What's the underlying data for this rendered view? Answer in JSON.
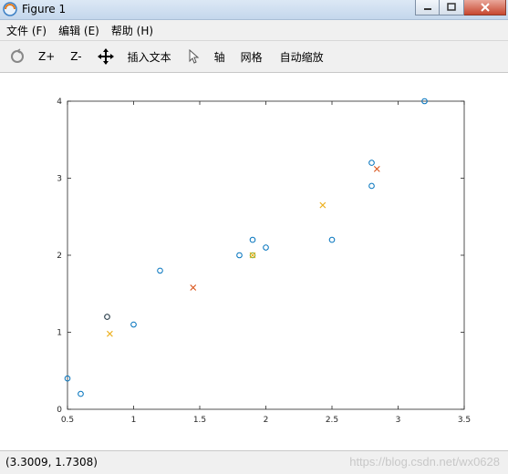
{
  "window": {
    "title": "Figure 1"
  },
  "menu": {
    "items": [
      "文件 (F)",
      "编辑 (E)",
      "帮助 (H)"
    ]
  },
  "toolbar": {
    "zoom_in": "Z+",
    "zoom_out": "Z-",
    "insert_text": "插入文本",
    "axes": "轴",
    "grid": "网格",
    "autoscale": "自动缩放"
  },
  "status": {
    "coordinates": "(3.3009, 1.7308)",
    "watermark": "https://blog.csdn.net/wx0628"
  },
  "colors": {
    "data_points": "#0072bd",
    "centroid_initial": "#edb120",
    "centroid_final": "#d95319",
    "highlight": "#7e2f8e"
  },
  "chart_data": {
    "type": "scatter",
    "xlim": [
      0.5,
      3.5
    ],
    "ylim": [
      0,
      4
    ],
    "xticks": [
      "0.5",
      "1",
      "1.5",
      "2",
      "2.5",
      "3",
      "3.5"
    ],
    "yticks": [
      "0",
      "1",
      "2",
      "3",
      "4"
    ],
    "grid": false,
    "series": [
      {
        "marker": "o",
        "color": "#0072bd",
        "points": [
          [
            0.5,
            0.4
          ],
          [
            0.6,
            0.2
          ],
          [
            0.8,
            1.2
          ],
          [
            1.0,
            1.1
          ],
          [
            1.2,
            1.8
          ],
          [
            1.8,
            2.0
          ],
          [
            1.9,
            2.2
          ],
          [
            2.0,
            2.1
          ],
          [
            2.5,
            2.2
          ],
          [
            2.8,
            3.2
          ],
          [
            2.8,
            2.9
          ],
          [
            3.2,
            4.0
          ]
        ]
      },
      {
        "marker": "o",
        "color": "#77ac30",
        "points": [
          [
            1.9,
            2.0
          ]
        ]
      },
      {
        "marker": "o",
        "color": "#444444",
        "points": [
          [
            0.8,
            1.2
          ]
        ]
      },
      {
        "marker": "x",
        "color": "#edb120",
        "points": [
          [
            0.82,
            0.98
          ],
          [
            1.9,
            2.0
          ],
          [
            2.43,
            2.65
          ]
        ]
      },
      {
        "marker": "x",
        "color": "#d95319",
        "points": [
          [
            1.45,
            1.58
          ],
          [
            2.84,
            3.12
          ]
        ]
      }
    ]
  }
}
